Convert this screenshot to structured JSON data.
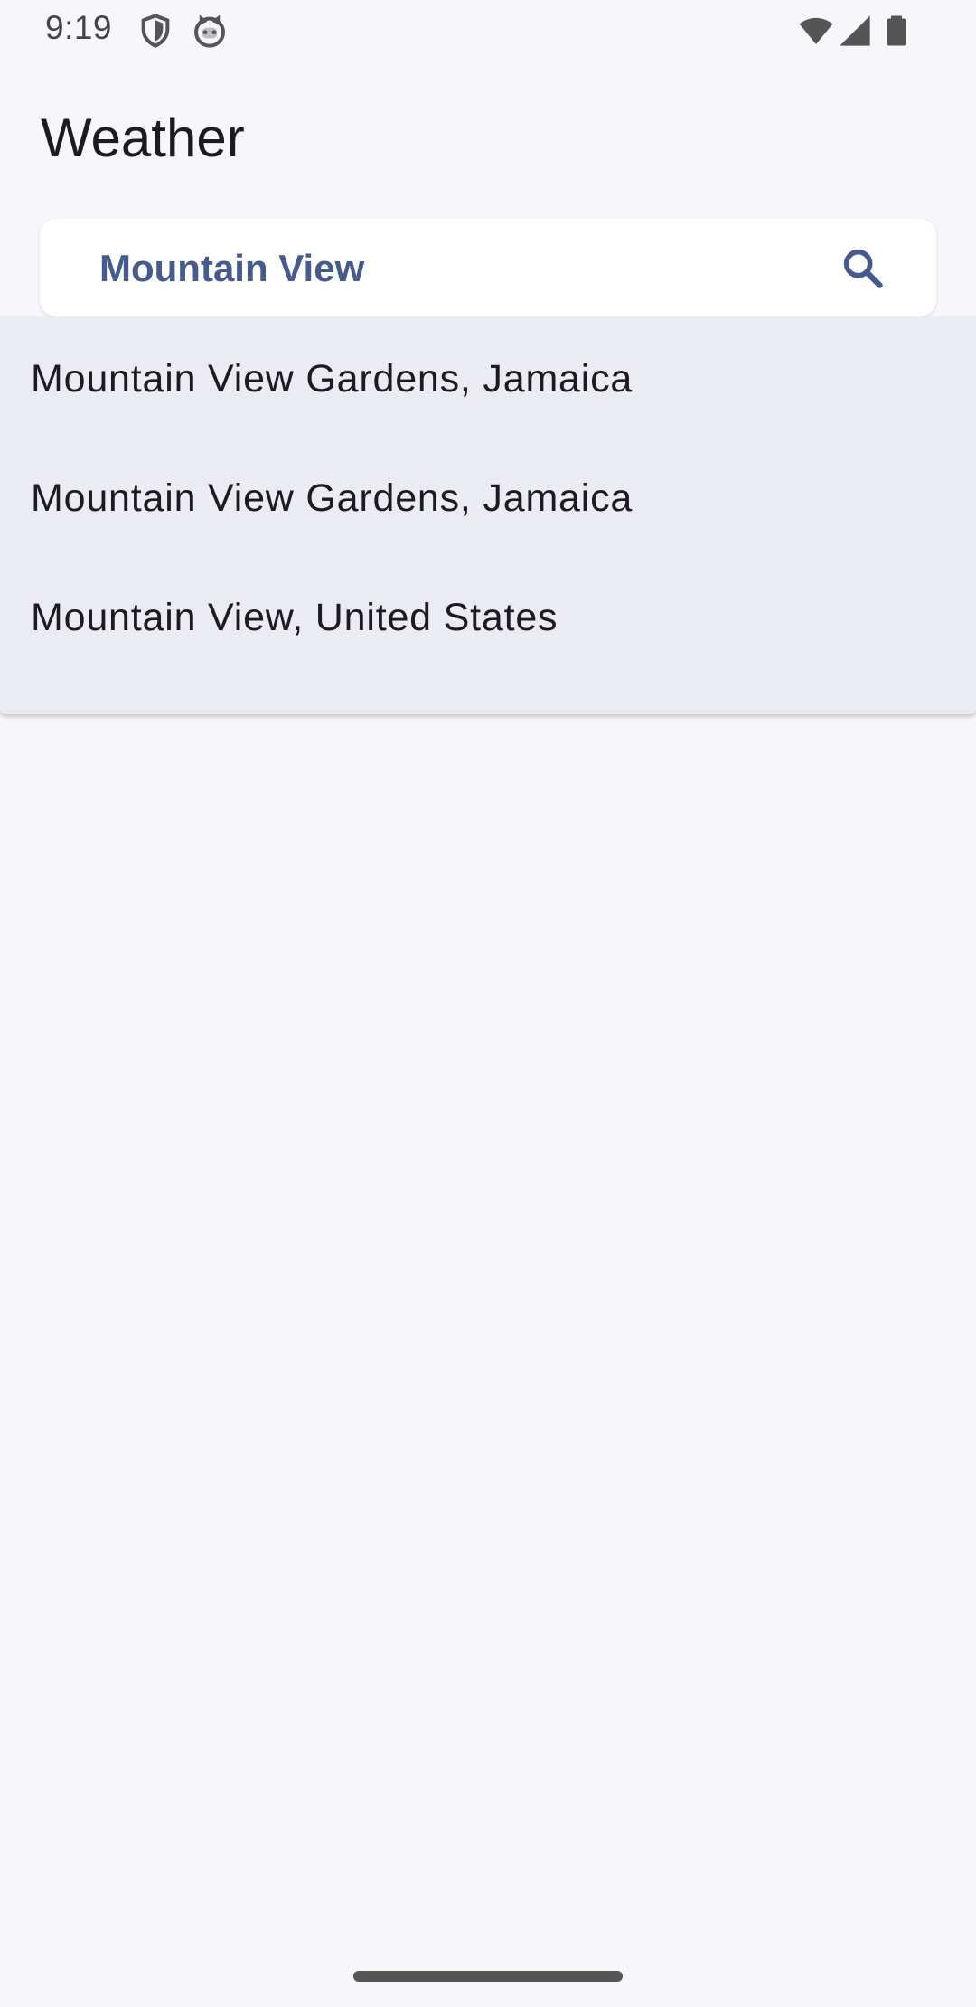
{
  "status_bar": {
    "time": "9:19",
    "icons": [
      "shield-icon",
      "cat-face-icon",
      "wifi-icon",
      "cellular-signal-icon",
      "battery-icon"
    ]
  },
  "app": {
    "title": "Weather"
  },
  "search": {
    "value": "Mountain View",
    "icon": "search-icon",
    "accent_color": "#475a8e"
  },
  "suggestions": [
    {
      "label": "Mountain View Gardens, Jamaica"
    },
    {
      "label": "Mountain View Gardens, Jamaica"
    },
    {
      "label": "Mountain View, United States"
    }
  ],
  "colors": {
    "background": "#f6f6fb",
    "dropdown": "#ebebf3",
    "text": "#1c1b1f"
  }
}
